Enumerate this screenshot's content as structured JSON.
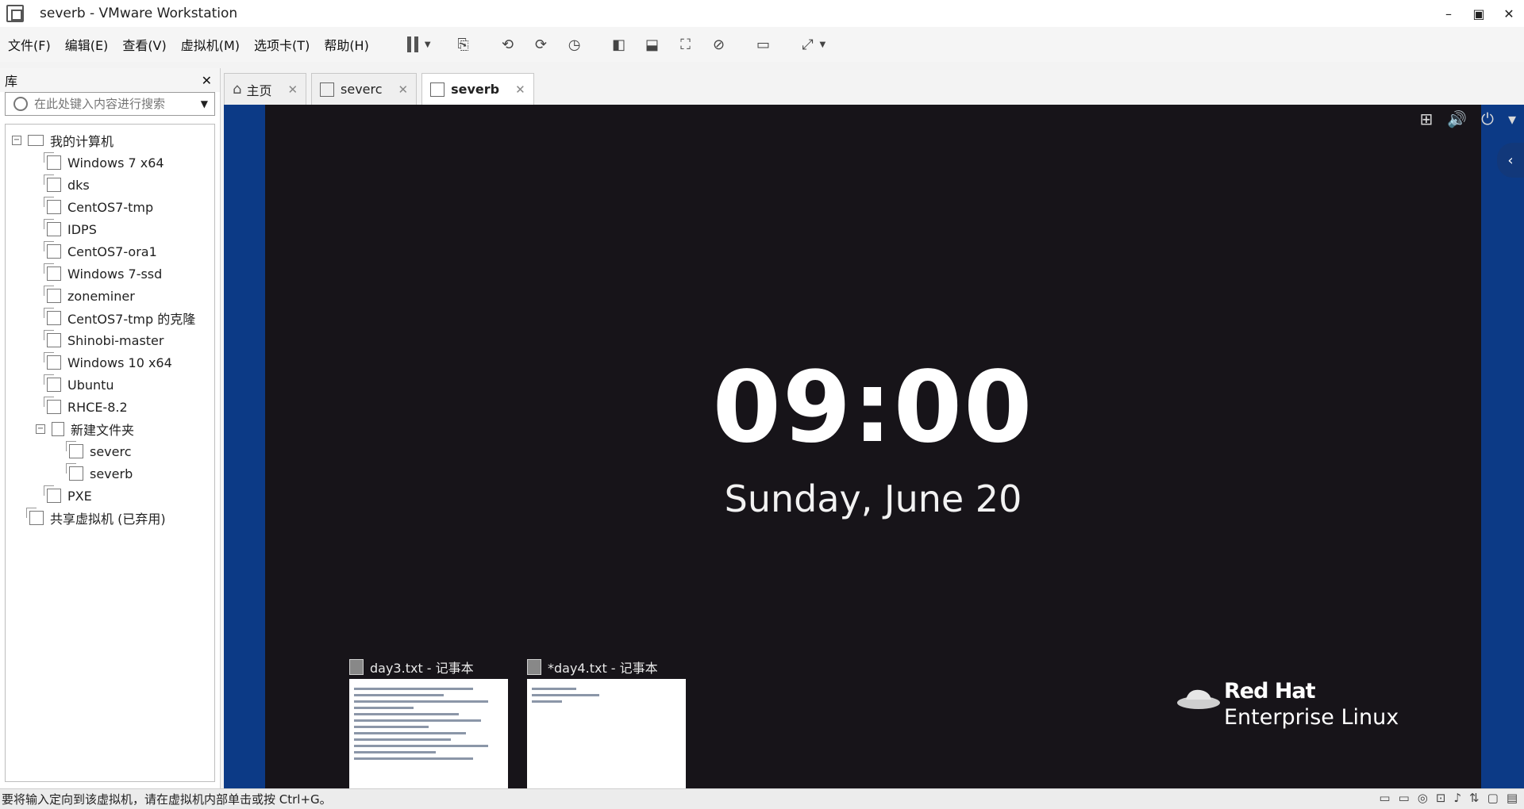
{
  "window": {
    "title": "severb - VMware Workstation"
  },
  "menu": [
    "文件(F)",
    "编辑(E)",
    "查看(V)",
    "虚拟机(M)",
    "选项卡(T)",
    "帮助(H)"
  ],
  "library": {
    "title": "库",
    "search_placeholder": "在此处键入内容进行搜索",
    "root": "我的计算机",
    "items": [
      "Windows 7 x64",
      "dks",
      "CentOS7-tmp",
      "IDPS",
      "CentOS7-ora1",
      "Windows 7-ssd",
      "zoneminer",
      "CentOS7-tmp 的克隆",
      "Shinobi-master",
      "Windows 10 x64",
      "Ubuntu",
      "RHCE-8.2"
    ],
    "folder": "新建文件夹",
    "folder_items": [
      "severc",
      "severb"
    ],
    "after_folder": "PXE",
    "shared": "共享虚拟机 (已弃用)"
  },
  "tabs": [
    {
      "label": "主页"
    },
    {
      "label": "severc"
    },
    {
      "label": "severb",
      "active": true
    }
  ],
  "vm": {
    "time": "09:00",
    "date": "Sunday, June 20",
    "brand_line1": "Red Hat",
    "brand_line2": "Enterprise Linux"
  },
  "taskbar_previews": [
    {
      "title": "day3.txt - 记事本"
    },
    {
      "title": "*day4.txt - 记事本"
    }
  ],
  "status": {
    "text": "要将输入定向到该虚拟机，请在虚拟机内部单击或按 Ctrl+G。"
  },
  "colors": {
    "vm_background": "#171419",
    "vm_border": "#0c3a86"
  }
}
